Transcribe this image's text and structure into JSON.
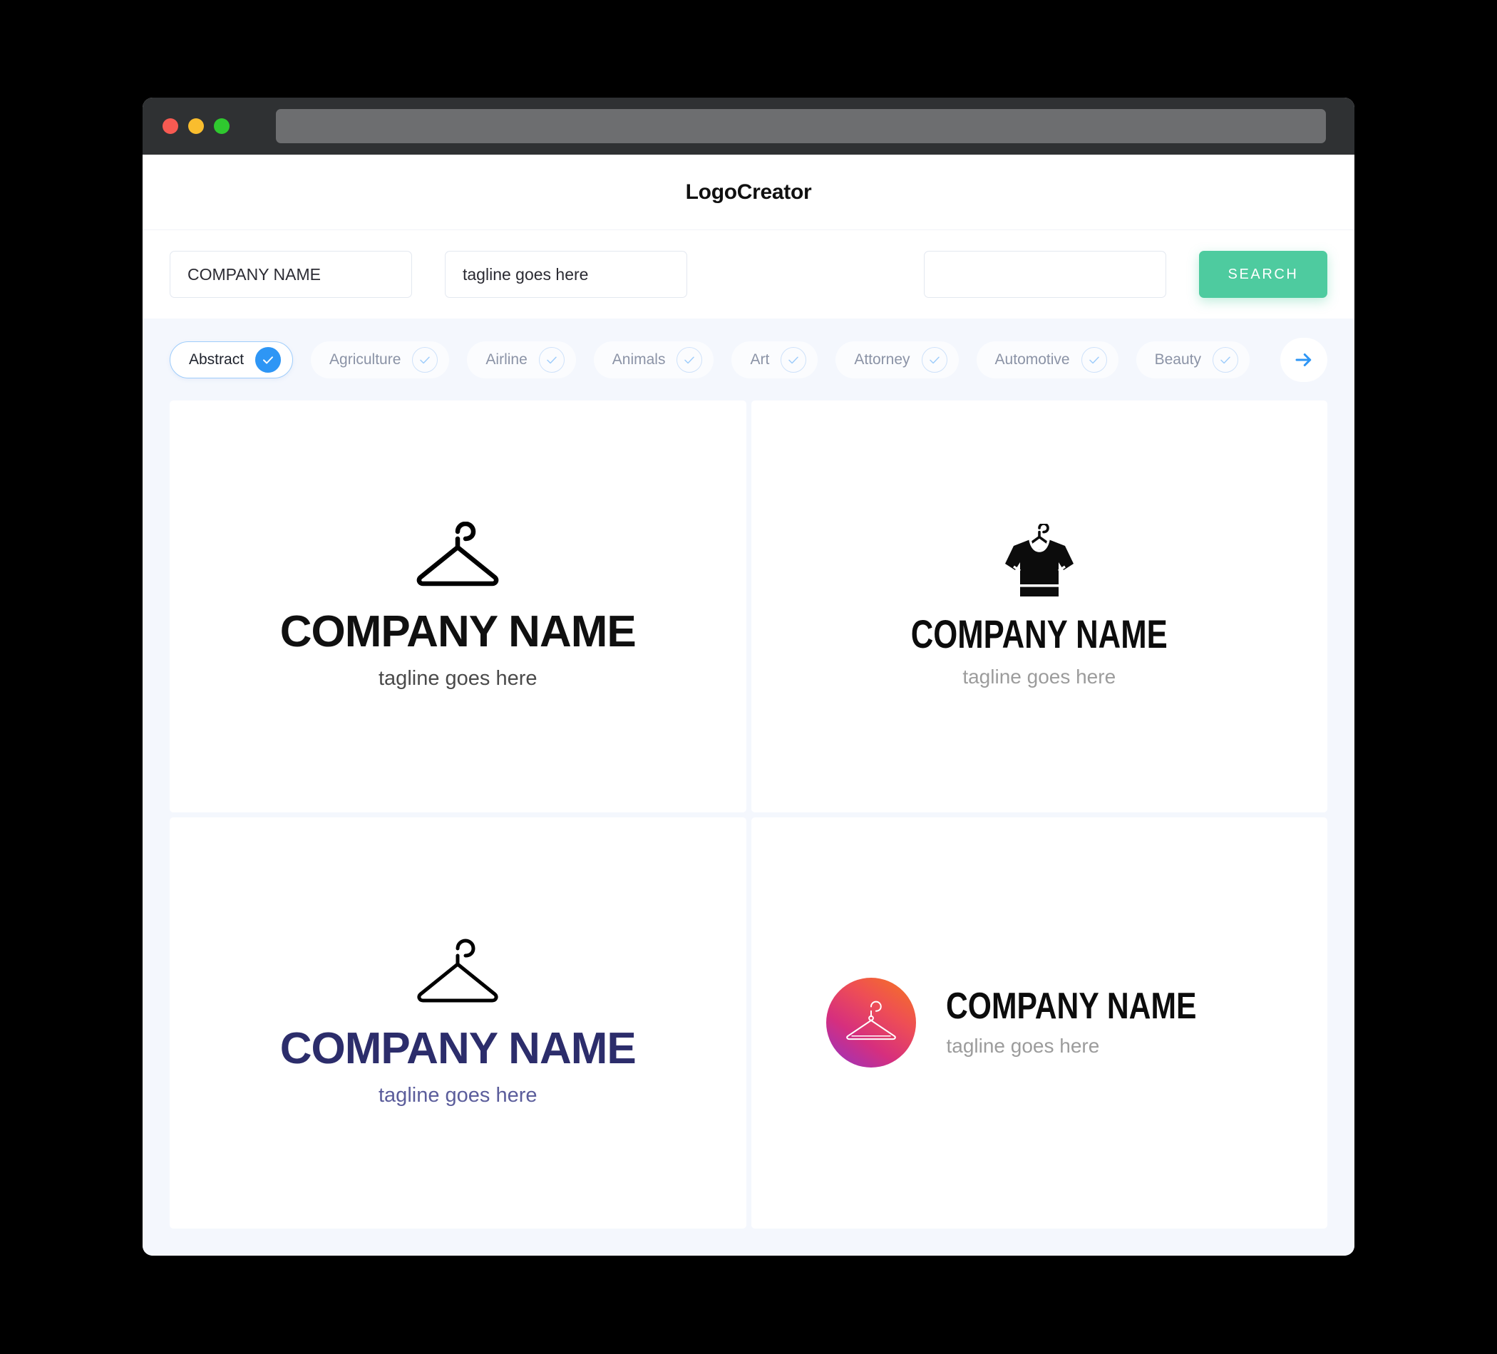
{
  "window": {
    "traffic_lights": [
      {
        "name": "close",
        "color": "#f75a52"
      },
      {
        "name": "minimize",
        "color": "#f9bd2e"
      },
      {
        "name": "maximize",
        "color": "#2fc82f"
      }
    ],
    "url_bar_value": ""
  },
  "header": {
    "app_title": "LogoCreator"
  },
  "search": {
    "company_name_value": "COMPANY NAME",
    "company_name_placeholder": "COMPANY NAME",
    "tagline_value": "tagline goes here",
    "tagline_placeholder": "tagline goes here",
    "keyword_value": "",
    "keyword_placeholder": "",
    "search_button_label": "SEARCH",
    "search_button_color": "#4ecb9f"
  },
  "categories": {
    "next_arrow_label": "→",
    "accent_color": "#2e96f5",
    "items": [
      {
        "label": "Abstract",
        "selected": true
      },
      {
        "label": "Agriculture",
        "selected": false
      },
      {
        "label": "Airline",
        "selected": false
      },
      {
        "label": "Animals",
        "selected": false
      },
      {
        "label": "Art",
        "selected": false
      },
      {
        "label": "Attorney",
        "selected": false
      },
      {
        "label": "Automotive",
        "selected": false
      },
      {
        "label": "Beauty",
        "selected": false
      }
    ]
  },
  "logos": [
    {
      "icon": "clothes-hanger-outline-icon",
      "name": "COMPANY NAME",
      "tagline": "tagline goes here",
      "name_color": "#101010",
      "tagline_color": "#4a4a4a",
      "layout": "stacked"
    },
    {
      "icon": "tshirt-on-hanger-icon",
      "name": "COMPANY NAME",
      "tagline": "tagline goes here",
      "name_color": "#0c0c0c",
      "tagline_color": "#9c9c9c",
      "layout": "stacked"
    },
    {
      "icon": "clothes-hanger-outline-icon",
      "name": "COMPANY NAME",
      "tagline": "tagline goes here",
      "name_color": "#2c2d6b",
      "tagline_color": "#5b5d9b",
      "layout": "stacked"
    },
    {
      "icon": "gradient-circle-hanger-icon",
      "name": "COMPANY NAME",
      "tagline": "tagline goes here",
      "name_color": "#0c0c0c",
      "tagline_color": "#9c9c9c",
      "layout": "horizontal",
      "badge_gradient": [
        "#9333c6",
        "#d62f7e",
        "#ee4e55",
        "#f5761f"
      ]
    }
  ]
}
